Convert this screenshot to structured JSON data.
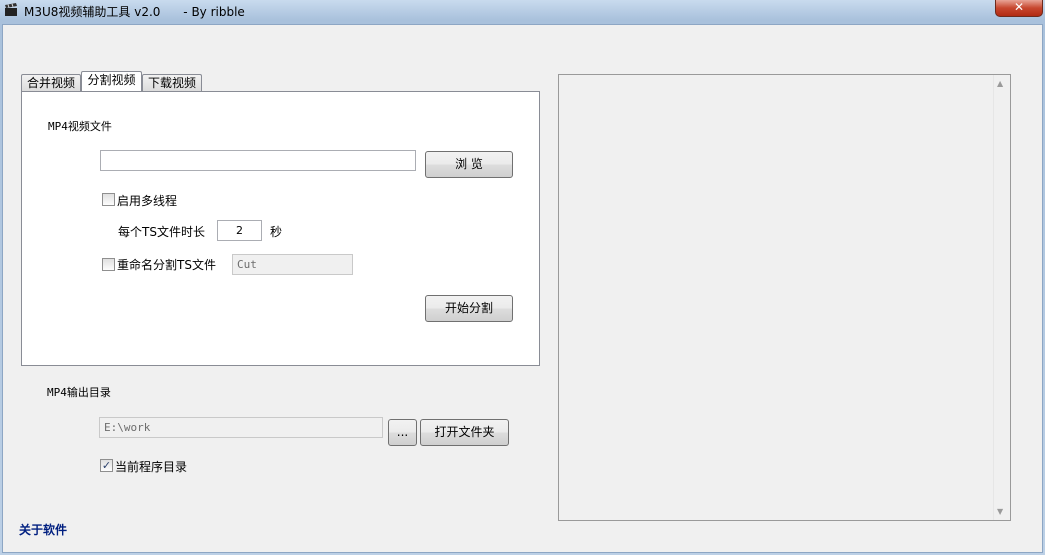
{
  "window": {
    "title": "M3U8视频辅助工具 v2.0      - By ribble",
    "close_glyph": "✕"
  },
  "tabs": [
    {
      "label": "合并视频"
    },
    {
      "label": "分割视频"
    },
    {
      "label": "下载视频"
    }
  ],
  "split": {
    "mp4_file_label": "MP4视频文件",
    "mp4_file_value": "",
    "browse_label": "浏 览",
    "multithread_label": "启用多线程",
    "multithread_checked": false,
    "ts_duration_label": "每个TS文件时长",
    "ts_duration_value": "2",
    "ts_duration_unit": "秒",
    "rename_label": "重命名分割TS文件",
    "rename_checked": false,
    "rename_value": "Cut",
    "start_label": "开始分割"
  },
  "output": {
    "dir_label": "MP4输出目录",
    "dir_value": "E:\\work",
    "pick_label": "...",
    "open_folder_label": "打开文件夹",
    "current_dir_label": "当前程序目录",
    "current_dir_checked": true,
    "check_glyph": "✓"
  },
  "log": {
    "up_arrow": "▲",
    "down_arrow": "▼"
  },
  "about_label": "关于软件"
}
